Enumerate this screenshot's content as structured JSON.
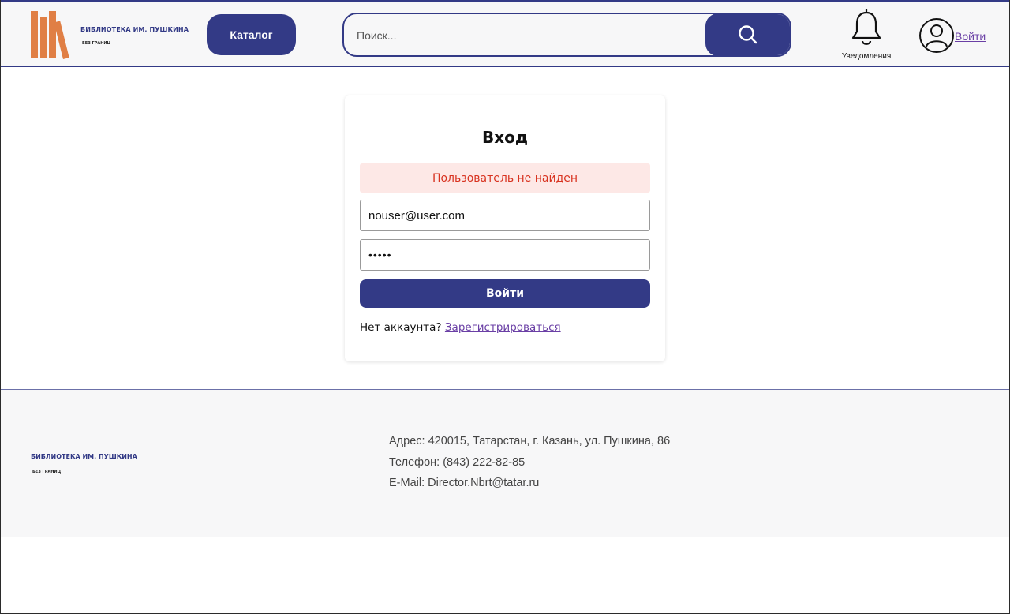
{
  "header": {
    "logo": {
      "title": "БИБЛИОТЕКА ИМ. ПУШКИНА",
      "subtitle": "БЕЗ ГРАНИЦ"
    },
    "catalog_label": "Каталог",
    "search": {
      "placeholder": "Поиск...",
      "value": ""
    },
    "notifications_label": "Уведомления",
    "login_label": "Войти"
  },
  "login_form": {
    "title": "Вход",
    "error": "Пользователь не найден",
    "email_value": "nouser@user.com",
    "password_value": "•••••",
    "submit_label": "Войти",
    "no_account_text": "Нет аккаунта?",
    "register_link": "Зарегистрироваться"
  },
  "footer": {
    "logo": {
      "title": "БИБЛИОТЕКА ИМ. ПУШКИНА",
      "subtitle": "БЕЗ ГРАНИЦ"
    },
    "address": "Адрес: 420015, Татарстан, г. Казань, ул. Пушкина, 86",
    "phone": "Телефон: (843) 222-82-85",
    "email": "E-Mail: Director.Nbrt@tatar.ru"
  },
  "colors": {
    "brand": "#333a86",
    "logo_books": "#e07f45",
    "error_text": "#d8321f",
    "error_bg": "#fde8e6",
    "link": "#6a3fa5"
  },
  "icons": {
    "logo": "books-logo-icon",
    "search": "search-icon",
    "notifications": "bell-icon",
    "account": "user-icon"
  }
}
